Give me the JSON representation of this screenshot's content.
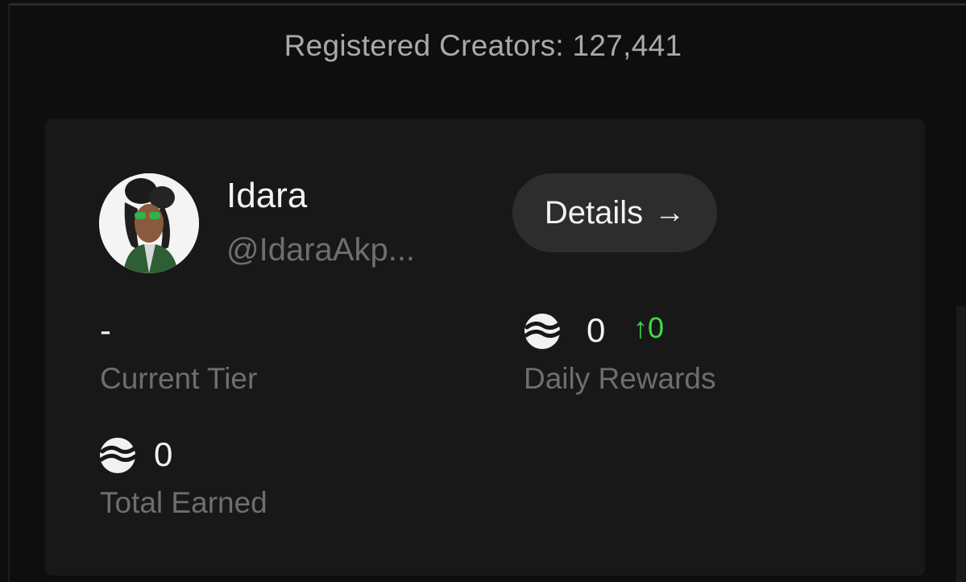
{
  "header": {
    "registered_creators": "Registered Creators: 127,441"
  },
  "profile": {
    "name": "Idara",
    "handle": "@IdaraAkp...",
    "details_label": "Details",
    "details_arrow": "→"
  },
  "stats": {
    "current_tier": {
      "value": "-",
      "label": "Current Tier"
    },
    "daily_rewards": {
      "value": "0",
      "change": "↑0",
      "label": "Daily Rewards",
      "icon": "coin-icon"
    },
    "total_earned": {
      "value": "0",
      "label": "Total Earned",
      "icon": "coin-icon"
    }
  },
  "colors": {
    "background": "#0e0e0e",
    "card": "#181818",
    "button": "#2d2d2d",
    "text_primary": "#f2f2f2",
    "text_muted": "#6e6e6e",
    "positive": "#3ddc47"
  }
}
